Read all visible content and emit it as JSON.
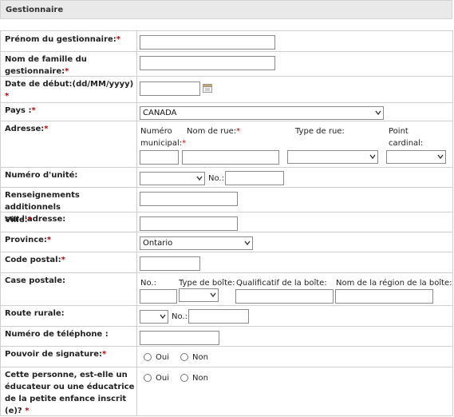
{
  "section": {
    "title": "Gestionnaire"
  },
  "required_mark": "*",
  "fields": {
    "prenom": {
      "label": "Prénom du gestionnaire:"
    },
    "nom": {
      "label_line1": "Nom de famille du",
      "label_line2": "gestionnaire:"
    },
    "date": {
      "label": "Date de début:(dd/MM/yyyy)"
    },
    "pays": {
      "label": "Pays :",
      "value": "CANADA"
    },
    "adresse": {
      "label": "Adresse:",
      "numero_label_1": "Numéro",
      "numero_label_2": "municipal:",
      "rue_label": "Nom de rue:",
      "type_rue_label": "Type de rue:",
      "point_label_1": "Point",
      "point_label_2": "cardinal:"
    },
    "unite": {
      "label": "Numéro d'unité:",
      "no_label": "No.:"
    },
    "renseignements": {
      "label_line1": "Renseignements additionnels",
      "label_line2": "sur l'adresse:"
    },
    "ville": {
      "label": "Ville:"
    },
    "province": {
      "label": "Province:",
      "value": "Ontario"
    },
    "code_postal": {
      "label": "Code postal:"
    },
    "case_postale": {
      "label": "Case postale:",
      "no_label": "No.:",
      "type_label": "Type de boîte:",
      "qualificatif_label": "Qualificatif de la boîte:",
      "region_label": "Nom de la région de la boîte:"
    },
    "route": {
      "label": "Route rurale:",
      "no_label": "No.:"
    },
    "telephone": {
      "label": "Numéro de téléphone :"
    },
    "pouvoir": {
      "label": "Pouvoir de signature:",
      "oui": "Oui",
      "non": "Non"
    },
    "educateur": {
      "label_line1": "Cette personne, est-elle un",
      "label_line2": "éducateur ou une éducatrice",
      "label_line3": "de la petite enfance inscrit",
      "label_line4": "(e)?",
      "oui": "Oui",
      "non": "Non"
    }
  }
}
